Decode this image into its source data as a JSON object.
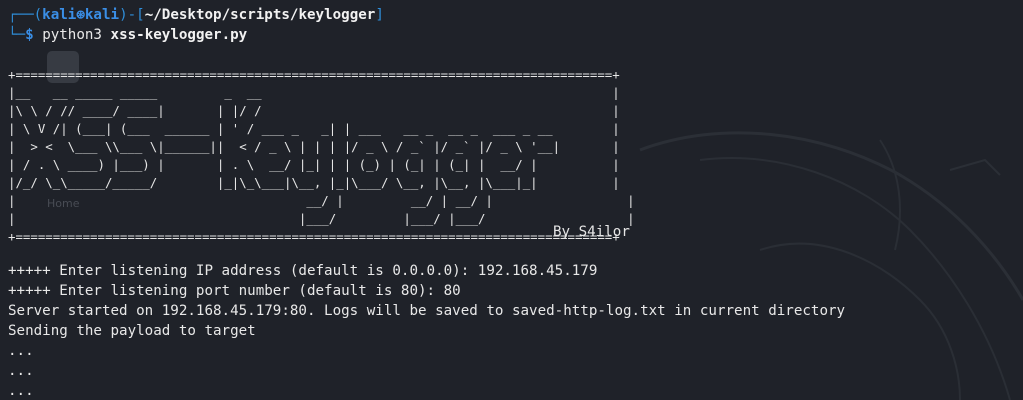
{
  "prompt": {
    "corner_top": "┌──",
    "user_host_open": "(",
    "user": "kali",
    "at_glyph": "⊛",
    "host": "kali",
    "user_host_close": ")",
    "dash": "-",
    "path_open": "[",
    "path": "~/Desktop/scripts/keylogger",
    "path_close": "]",
    "corner_bottom": "└─",
    "dollar": "$",
    "command": "python3",
    "argument": "xss-keylogger.py"
  },
  "banner": {
    "lines": [
      "+================================================================================+",
      "|__   __ _____ _____         _  __                                               |",
      "|\\ \\ / // ____/ ____|       | |/ /                                               |",
      "| \\ V /| (___| (___  ______ | ' / ___ _   _| | ___   __ _  __ _  ___ _ __        |",
      "|  > <  \\___ \\\\___ \\|______||  < / _ \\ | | | |/ _ \\ / _` |/ _` |/ _ \\ '__|       |",
      "| / . \\ ____) |___) |       | . \\  __/ |_| | | (_) | (_| | (_| |  __/ |          |",
      "|/_/ \\_\\_____/_____/        |_|\\_\\___|\\__, |_|\\___/ \\__, |\\__, |\\___|_|          |",
      "|                                       __/ |         __/ | __/ |                  |",
      "|                                      |___/         |___/ |___/                   |",
      "+================================================================================+"
    ],
    "author": "By S4ilor"
  },
  "output": {
    "lines": [
      "+++++ Enter listening IP address (default is 0.0.0.0): 192.168.45.179",
      "+++++ Enter listening port number (default is 80): 80",
      "Server started on 192.168.45.179:80. Logs will be saved to saved-http-log.txt in current directory",
      "Sending the payload to target",
      "...",
      "...",
      "..."
    ]
  },
  "desktop_ghost": {
    "label": "Home"
  },
  "colors": {
    "background": "#1f2229",
    "prompt_blue": "#3a8ee6",
    "text": "#e8e8e8"
  }
}
